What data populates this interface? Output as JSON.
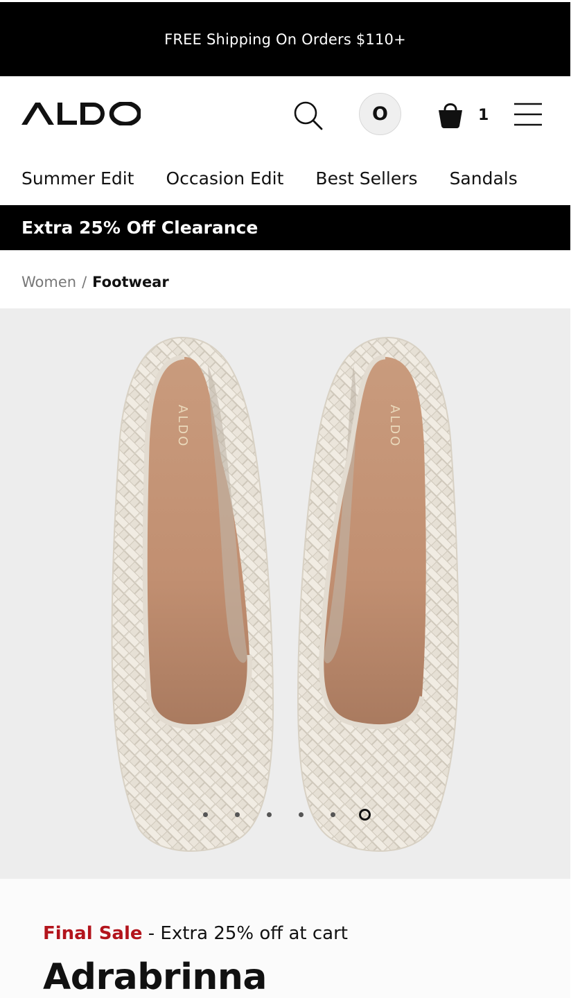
{
  "promo_bar": {
    "text": "FREE Shipping On Orders $110+"
  },
  "header": {
    "logo_text": "ALDO",
    "search_icon": "search-icon",
    "account_initial": "O",
    "cart_icon": "shopping-bag-icon",
    "cart_count": "1",
    "menu_icon": "hamburger-menu-icon"
  },
  "nav": {
    "items": [
      {
        "label": "Summer Edit"
      },
      {
        "label": "Occasion Edit"
      },
      {
        "label": "Best Sellers"
      },
      {
        "label": "Sandals"
      }
    ]
  },
  "clearance_bar": {
    "text": "Extra 25% Off Clearance"
  },
  "breadcrumb": {
    "parent": "Women",
    "separator": "/",
    "current": "Footwear"
  },
  "gallery": {
    "insole_brand": "ALDO",
    "image_count": 6,
    "active_index": 6
  },
  "product": {
    "sale_tag": "Final Sale",
    "sale_text": " - Extra 25% off at cart",
    "name": "Adrabrinna"
  },
  "colors": {
    "promo_background": "#000000",
    "sale_red": "#b3141c",
    "gallery_background": "#ededed",
    "shoe_upper": "#ebe6dc",
    "insole": "#c9967a"
  }
}
